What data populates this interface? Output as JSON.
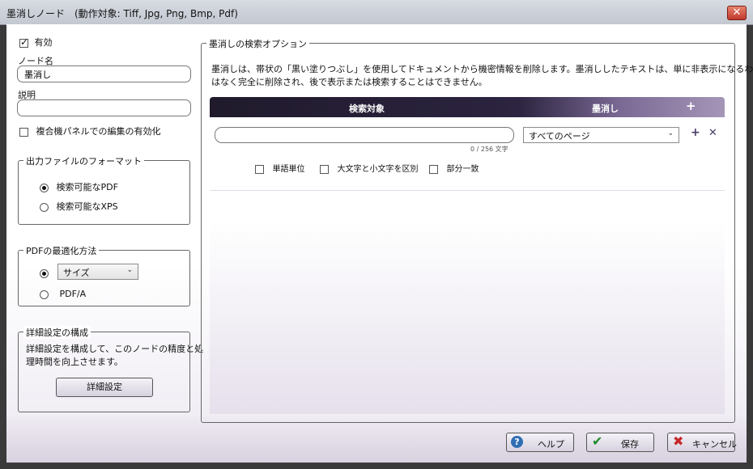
{
  "window": {
    "title": "墨消しノード　(動作対象: Tiff, Jpg, Png, Bmp, Pdf)",
    "close_glyph": "✕"
  },
  "left": {
    "enabled_label": "有効",
    "enabled_checked": true,
    "node_name_label": "ノード名",
    "node_name_value": "墨消し",
    "description_label": "説明",
    "description_value": "",
    "mfp_panel_label": "複合機パネルでの編集の有効化",
    "mfp_panel_checked": false,
    "output_format": {
      "legend": "出力ファイルのフォーマット",
      "options": [
        "検索可能なPDF",
        "検索可能なXPS"
      ],
      "selected_index": 0
    },
    "pdf_optimization": {
      "legend": "PDFの最適化方法",
      "size_option_value": "サイズ",
      "pdfa_label": "PDF/A",
      "selected": "size"
    },
    "advanced": {
      "legend": "詳細設定の構成",
      "description": "詳細設定を構成して、このノードの精度と処理時間を向上させます。",
      "description_line1": "詳細設定を構成して、このノードの精度と処",
      "description_line2": "理時間を向上させます。",
      "button_label": "詳細設定"
    }
  },
  "right": {
    "legend": "墨消しの検索オプション",
    "description_line1": "墨消しは、帯状の「黒い塗りつぶし」を使用してドキュメントから機密情報を削除します。墨消ししたテキストは、単に非表示になるわけで",
    "description_line2": "はなく完全に削除され、後で表示または検索することはできません。",
    "header": {
      "search_target": "検索対象",
      "redact": "墨消し",
      "add_glyph": "+"
    },
    "row": {
      "search_value": "",
      "char_count": "0 / 256 文字",
      "pages_value": "すべてのページ",
      "add_glyph": "+",
      "remove_glyph": "✕",
      "options": [
        {
          "label": "単語単位",
          "checked": false
        },
        {
          "label": "大文字と小文字を区別",
          "checked": false
        },
        {
          "label": "部分一致",
          "checked": false
        }
      ]
    }
  },
  "footer": {
    "help_label": "ヘルプ",
    "save_label": "保存",
    "cancel_label": "キャンセル"
  },
  "colors": {
    "header_dark": "#201a2c",
    "accent_purple": "#7b6a95",
    "save_check": "#1f8a2b",
    "cancel_x": "#c62828",
    "help_blue": "#2f6fb3"
  }
}
